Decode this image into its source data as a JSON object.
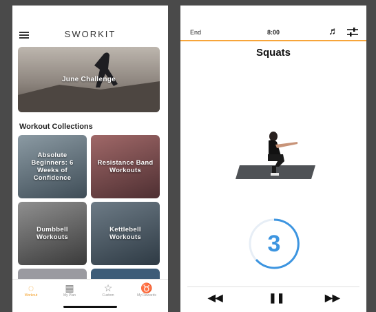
{
  "left": {
    "brand": "SWORKIT",
    "challenge_label": "June Challenge",
    "section_title": "Workout Collections",
    "collections": [
      {
        "label": "Absolute Beginners: 6 Weeks of Confidence"
      },
      {
        "label": "Resistance Band Workouts"
      },
      {
        "label": "Dumbbell Workouts"
      },
      {
        "label": "Kettlebell Workouts"
      }
    ],
    "tabs": [
      {
        "label": "Workout",
        "icon": "timer-icon"
      },
      {
        "label": "My Plan",
        "icon": "calendar-icon"
      },
      {
        "label": "Custom",
        "icon": "star-icon"
      },
      {
        "label": "My Rewards",
        "icon": "medal-icon"
      }
    ],
    "accent": "#f29a1b"
  },
  "right": {
    "end_label": "End",
    "timer": "8:00",
    "exercise": "Squats",
    "countdown": "3",
    "accent": "#f7a53a",
    "countdown_color": "#3d95e0"
  }
}
